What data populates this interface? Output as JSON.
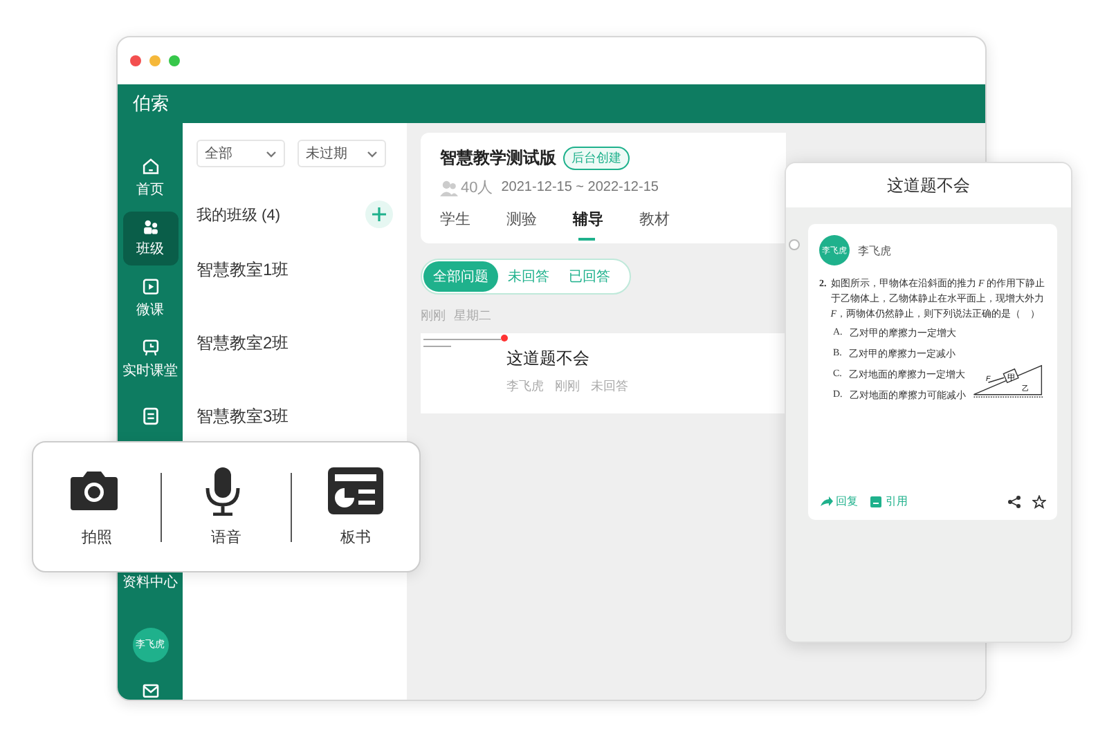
{
  "app": {
    "title": "伯索"
  },
  "sidebar": {
    "items": [
      {
        "kind": "home",
        "label": "首页",
        "selected": false
      },
      {
        "kind": "class",
        "label": "班级",
        "selected": true
      },
      {
        "kind": "video",
        "label": "微课",
        "selected": false
      },
      {
        "kind": "live",
        "label": "实时课堂",
        "selected": false
      },
      {
        "kind": "doc",
        "selected": false
      },
      {
        "label": "资料中心",
        "selected": false
      }
    ],
    "avatar": "李飞虎"
  },
  "class_list": {
    "filters": [
      "全部",
      "未过期"
    ],
    "heading": "我的班级 (4)",
    "classes": [
      "智慧教室1班",
      "智慧教室2班",
      "智慧教室3班"
    ]
  },
  "content": {
    "title": "智慧教学测试版",
    "badge": "后台创建",
    "count": "40人",
    "dates": "2021-12-15 ~ 2022-12-15",
    "tabs": [
      {
        "label": "学生",
        "selected": false
      },
      {
        "label": "测验",
        "selected": false
      },
      {
        "label": "辅导",
        "selected": true
      },
      {
        "label": "教材",
        "selected": false
      }
    ],
    "filters": [
      {
        "label": "全部问题",
        "selected": true
      },
      {
        "label": "未回答",
        "selected": false
      },
      {
        "label": "已回答",
        "selected": false
      }
    ],
    "day_labels": [
      "刚刚",
      "星期二"
    ],
    "question": {
      "title": "这道题不会",
      "author": "李飞虎",
      "time": "刚刚",
      "status": "未回答",
      "unread": true
    }
  },
  "detail": {
    "title": "这道题不会",
    "avatar": "李飞虎",
    "author": "李飞虎",
    "number": "2.",
    "text": "如图所示，甲物体在沿斜面的推力 *F* 的作用下静止于乙物体上，乙物体静止在水平面上，现增大外力 *F*，两物体仍然静止，则下列说法正确的是（　）",
    "options": [
      {
        "letter": "A.",
        "text": "乙对甲的摩擦力一定增大"
      },
      {
        "letter": "B.",
        "text": "乙对甲的摩擦力一定减小"
      },
      {
        "letter": "C.",
        "text": "乙对地面的摩擦力一定增大"
      },
      {
        "letter": "D.",
        "text": "乙对地面的摩擦力可能减小"
      }
    ],
    "diagram_labels": [
      "F",
      "甲",
      "乙"
    ],
    "actions": [
      "回复",
      "引用"
    ]
  },
  "tools": [
    {
      "kind": "camera",
      "label": "拍照"
    },
    {
      "kind": "mic",
      "label": "语音"
    },
    {
      "kind": "board",
      "label": "板书"
    }
  ]
}
